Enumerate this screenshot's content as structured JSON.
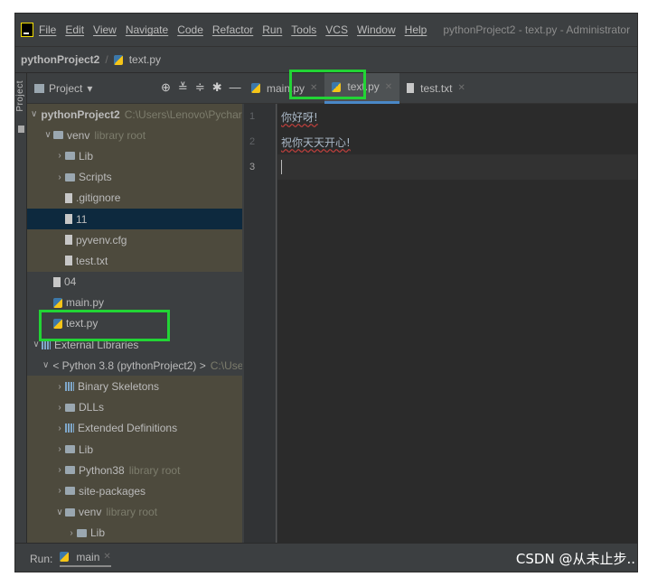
{
  "menubar": {
    "items": [
      "File",
      "Edit",
      "View",
      "Navigate",
      "Code",
      "Refactor",
      "Run",
      "Tools",
      "VCS",
      "Window",
      "Help"
    ],
    "window_title": "pythonProject2 - text.py - Administrator"
  },
  "breadcrumb": {
    "project": "pythonProject2",
    "file": "text.py"
  },
  "toolstrip": {
    "label": "Project"
  },
  "project_panel": {
    "title": "Project",
    "tools": [
      "⊕",
      "≚",
      "≑",
      "✱",
      "—"
    ],
    "tree": [
      {
        "arrow": "∨",
        "icon": "folder",
        "label": "pythonProject2",
        "hint": "C:\\Users\\Lenovo\\PycharmProjects\\",
        "bold": true,
        "indent": 0,
        "style": "lib"
      },
      {
        "arrow": "∨",
        "icon": "folder",
        "label": "venv",
        "hint": "library root",
        "indent": 1,
        "style": "lib"
      },
      {
        "arrow": "›",
        "icon": "folder",
        "label": "Lib",
        "hint": "",
        "indent": 2,
        "style": "lib"
      },
      {
        "arrow": "›",
        "icon": "folder",
        "label": "Scripts",
        "hint": "",
        "indent": 2,
        "style": "lib"
      },
      {
        "arrow": "",
        "icon": "file",
        "label": ".gitignore",
        "hint": "",
        "indent": 2,
        "style": "lib"
      },
      {
        "arrow": "",
        "icon": "file",
        "label": "11",
        "hint": "",
        "indent": 2,
        "style": "sel"
      },
      {
        "arrow": "",
        "icon": "file",
        "label": "pyvenv.cfg",
        "hint": "",
        "indent": 2,
        "style": "lib"
      },
      {
        "arrow": "",
        "icon": "file",
        "label": "test.txt",
        "hint": "",
        "indent": 2,
        "style": "lib"
      },
      {
        "arrow": "",
        "icon": "file",
        "label": "04",
        "hint": "",
        "indent": 1,
        "style": ""
      },
      {
        "arrow": "",
        "icon": "py",
        "label": "main.py",
        "hint": "",
        "indent": 1,
        "style": ""
      },
      {
        "arrow": "",
        "icon": "py",
        "label": "text.py",
        "hint": "",
        "indent": 1,
        "style": ""
      },
      {
        "arrow": "∨",
        "icon": "libs",
        "label": "External Libraries",
        "hint": "",
        "indent": 0,
        "style": ""
      },
      {
        "arrow": "∨",
        "icon": "py",
        "label": "< Python 3.8 (pythonProject2) >",
        "hint": "C:\\Users\\Lenovo",
        "indent": 1,
        "style": ""
      },
      {
        "arrow": "›",
        "icon": "libs",
        "label": "Binary Skeletons",
        "hint": "",
        "indent": 2,
        "style": "lib"
      },
      {
        "arrow": "›",
        "icon": "folder",
        "label": "DLLs",
        "hint": "",
        "indent": 2,
        "style": "lib"
      },
      {
        "arrow": "›",
        "icon": "libs",
        "label": "Extended Definitions",
        "hint": "",
        "indent": 2,
        "style": "lib"
      },
      {
        "arrow": "›",
        "icon": "folder",
        "label": "Lib",
        "hint": "",
        "indent": 2,
        "style": "lib"
      },
      {
        "arrow": "›",
        "icon": "folder",
        "label": "Python38",
        "hint": "library root",
        "indent": 2,
        "style": "lib"
      },
      {
        "arrow": "›",
        "icon": "folder",
        "label": "site-packages",
        "hint": "",
        "indent": 2,
        "style": "lib"
      },
      {
        "arrow": "∨",
        "icon": "folder",
        "label": "venv",
        "hint": "library root",
        "indent": 2,
        "style": "lib"
      },
      {
        "arrow": "›",
        "icon": "folder",
        "label": "Lib",
        "hint": "",
        "indent": 3,
        "style": "lib"
      }
    ]
  },
  "editor": {
    "tabs": [
      {
        "label": "main.py",
        "icon": "py",
        "active": false
      },
      {
        "label": "text.py",
        "icon": "py",
        "active": true
      },
      {
        "label": "test.txt",
        "icon": "file",
        "active": false
      }
    ],
    "line_numbers": [
      "1",
      "2",
      "3"
    ],
    "lines": [
      "你好呀!",
      "祝你天天开心!",
      ""
    ]
  },
  "runbar": {
    "label": "Run:",
    "tab": "main"
  },
  "watermark": "CSDN @从未止步..",
  "colors": {
    "highlight": "#22d435",
    "accent": "#4a88c7",
    "library_bg": "#4d4a3d",
    "selection_bg": "#0d293e"
  }
}
